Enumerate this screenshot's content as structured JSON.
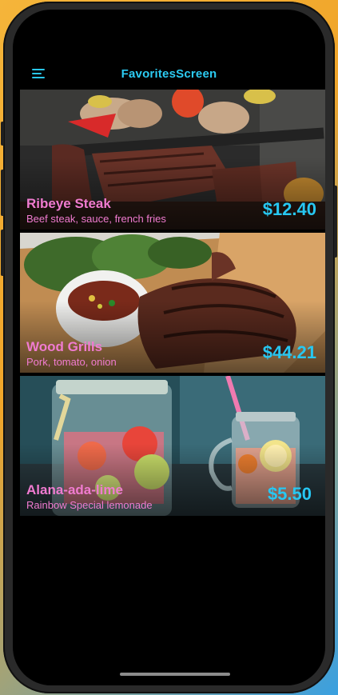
{
  "header": {
    "title": "FavoritesScreen",
    "menu_icon": "menu-icon"
  },
  "favorites": [
    {
      "name": "Ribeye Steak",
      "description": "Beef steak, sauce, french fries",
      "price": "$12.40"
    },
    {
      "name": "Wood Grills",
      "description": "Pork, tomato, onion",
      "price": "$44.21"
    },
    {
      "name": "Alana-ada-lime",
      "description": "Rainbow Special lemonade",
      "price": "$5.50"
    }
  ],
  "colors": {
    "accent": "#2ccbf2",
    "item_text": "#f07bd0",
    "background": "#000000"
  }
}
